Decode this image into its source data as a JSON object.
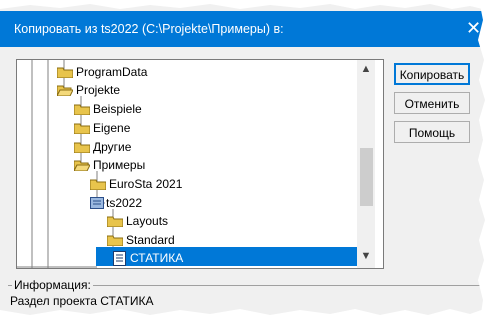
{
  "dialog": {
    "title": "Копировать из ts2022 (C:\\Projekte\\Примеры) в:",
    "close_icon": "close-icon"
  },
  "tree": {
    "items": [
      {
        "label": "ProgramData",
        "icon": "folder-icon"
      },
      {
        "label": "Projekte",
        "icon": "folder-open-icon"
      },
      {
        "label": "Beispiele",
        "icon": "folder-icon"
      },
      {
        "label": "Eigene",
        "icon": "folder-icon"
      },
      {
        "label": "Другие",
        "icon": "folder-icon"
      },
      {
        "label": "Примеры",
        "icon": "folder-open-icon"
      },
      {
        "label": "EuroSta 2021",
        "icon": "folder-icon"
      },
      {
        "label": "ts2022",
        "icon": "project-folder-icon"
      },
      {
        "label": "Layouts",
        "icon": "folder-icon"
      },
      {
        "label": "Standard",
        "icon": "folder-icon"
      },
      {
        "label": "СТАТИКА",
        "icon": "section-document-icon",
        "selected": true
      }
    ]
  },
  "buttons": {
    "copy": "Копировать",
    "cancel": "Отменить",
    "help": "Помощь"
  },
  "info": {
    "group_label": "Информация:",
    "text": "Раздел проекта СТАТИКА"
  },
  "colors": {
    "titlebar": "#0078d7",
    "selection": "#0078d7",
    "folder": "#e8c44c"
  }
}
